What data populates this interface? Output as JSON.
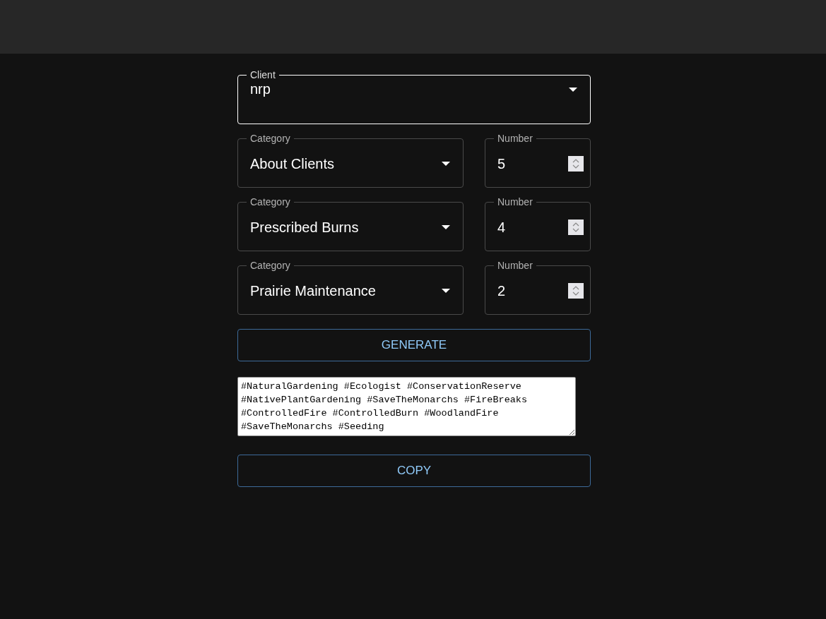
{
  "client": {
    "label": "Client",
    "value": "nrp",
    "focused": true
  },
  "rows": [
    {
      "category": {
        "label": "Category",
        "value": "About Clients"
      },
      "number": {
        "label": "Number",
        "value": "5"
      }
    },
    {
      "category": {
        "label": "Category",
        "value": "Prescribed Burns"
      },
      "number": {
        "label": "Number",
        "value": "4"
      }
    },
    {
      "category": {
        "label": "Category",
        "value": "Prairie Maintenance"
      },
      "number": {
        "label": "Number",
        "value": "2"
      }
    }
  ],
  "generate_button": "GENERATE",
  "output_lines": [
    "#NaturalGardening #Ecologist #ConservationReserve",
    "#NativePlantGardening #SaveTheMonarchs #FireBreaks",
    "#ControlledFire #ControlledBurn #WoodlandFire",
    "#SaveTheMonarchs #Seeding"
  ],
  "copy_button": "COPY"
}
